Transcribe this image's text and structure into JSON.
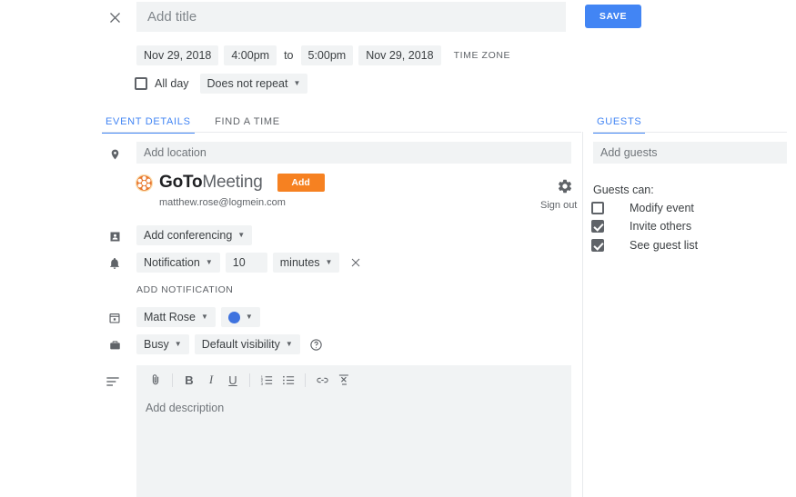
{
  "header": {
    "close_icon": "close-icon",
    "title_placeholder": "Add title",
    "title_value": "",
    "save_label": "SAVE"
  },
  "schedule": {
    "start_date": "Nov 29, 2018",
    "start_time": "4:00pm",
    "to_label": "to",
    "end_time": "5:00pm",
    "end_date": "Nov 29, 2018",
    "timezone_label": "TIME ZONE",
    "all_day_label": "All day",
    "all_day_checked": false,
    "repeat_label": "Does not repeat"
  },
  "tabs": {
    "event_details": "EVENT DETAILS",
    "find_a_time": "FIND A TIME",
    "active": "EVENT DETAILS"
  },
  "main": {
    "location_placeholder": "Add location",
    "location_value": "",
    "conferencing_label": "Add conferencing",
    "notification_type": "Notification",
    "notification_amount": "10",
    "notification_unit": "minutes",
    "add_notification_label": "ADD NOTIFICATION",
    "calendar_owner": "Matt Rose",
    "event_color": "#3f73df",
    "availability": "Busy",
    "visibility": "Default visibility",
    "description_placeholder": "Add description",
    "description_value": ""
  },
  "gotomeeting": {
    "brand_bold": "GoTo",
    "brand_light": "Meeting",
    "add_label": "Add",
    "email": "matthew.rose@logmein.com",
    "sign_out_label": "Sign out",
    "gear_icon": "gear-icon",
    "accent_color": "#f68121"
  },
  "editor_toolbar": {
    "attach": "attach-icon",
    "bold": "B",
    "italic": "I",
    "underline": "U",
    "numbered_list": "numbered-list-icon",
    "bulleted_list": "bulleted-list-icon",
    "link": "link-icon",
    "clear_format": "clear-formatting-icon"
  },
  "guests": {
    "tab_label": "GUESTS",
    "input_placeholder": "Add guests",
    "input_value": "",
    "guests_can_label": "Guests can:",
    "permissions": [
      {
        "label": "Modify event",
        "checked": false
      },
      {
        "label": "Invite others",
        "checked": true
      },
      {
        "label": "See guest list",
        "checked": true
      }
    ]
  },
  "colors": {
    "accent_blue": "#4285f4",
    "field_bg": "#f1f3f4",
    "text": "#3c4043",
    "muted": "#5f6368"
  }
}
